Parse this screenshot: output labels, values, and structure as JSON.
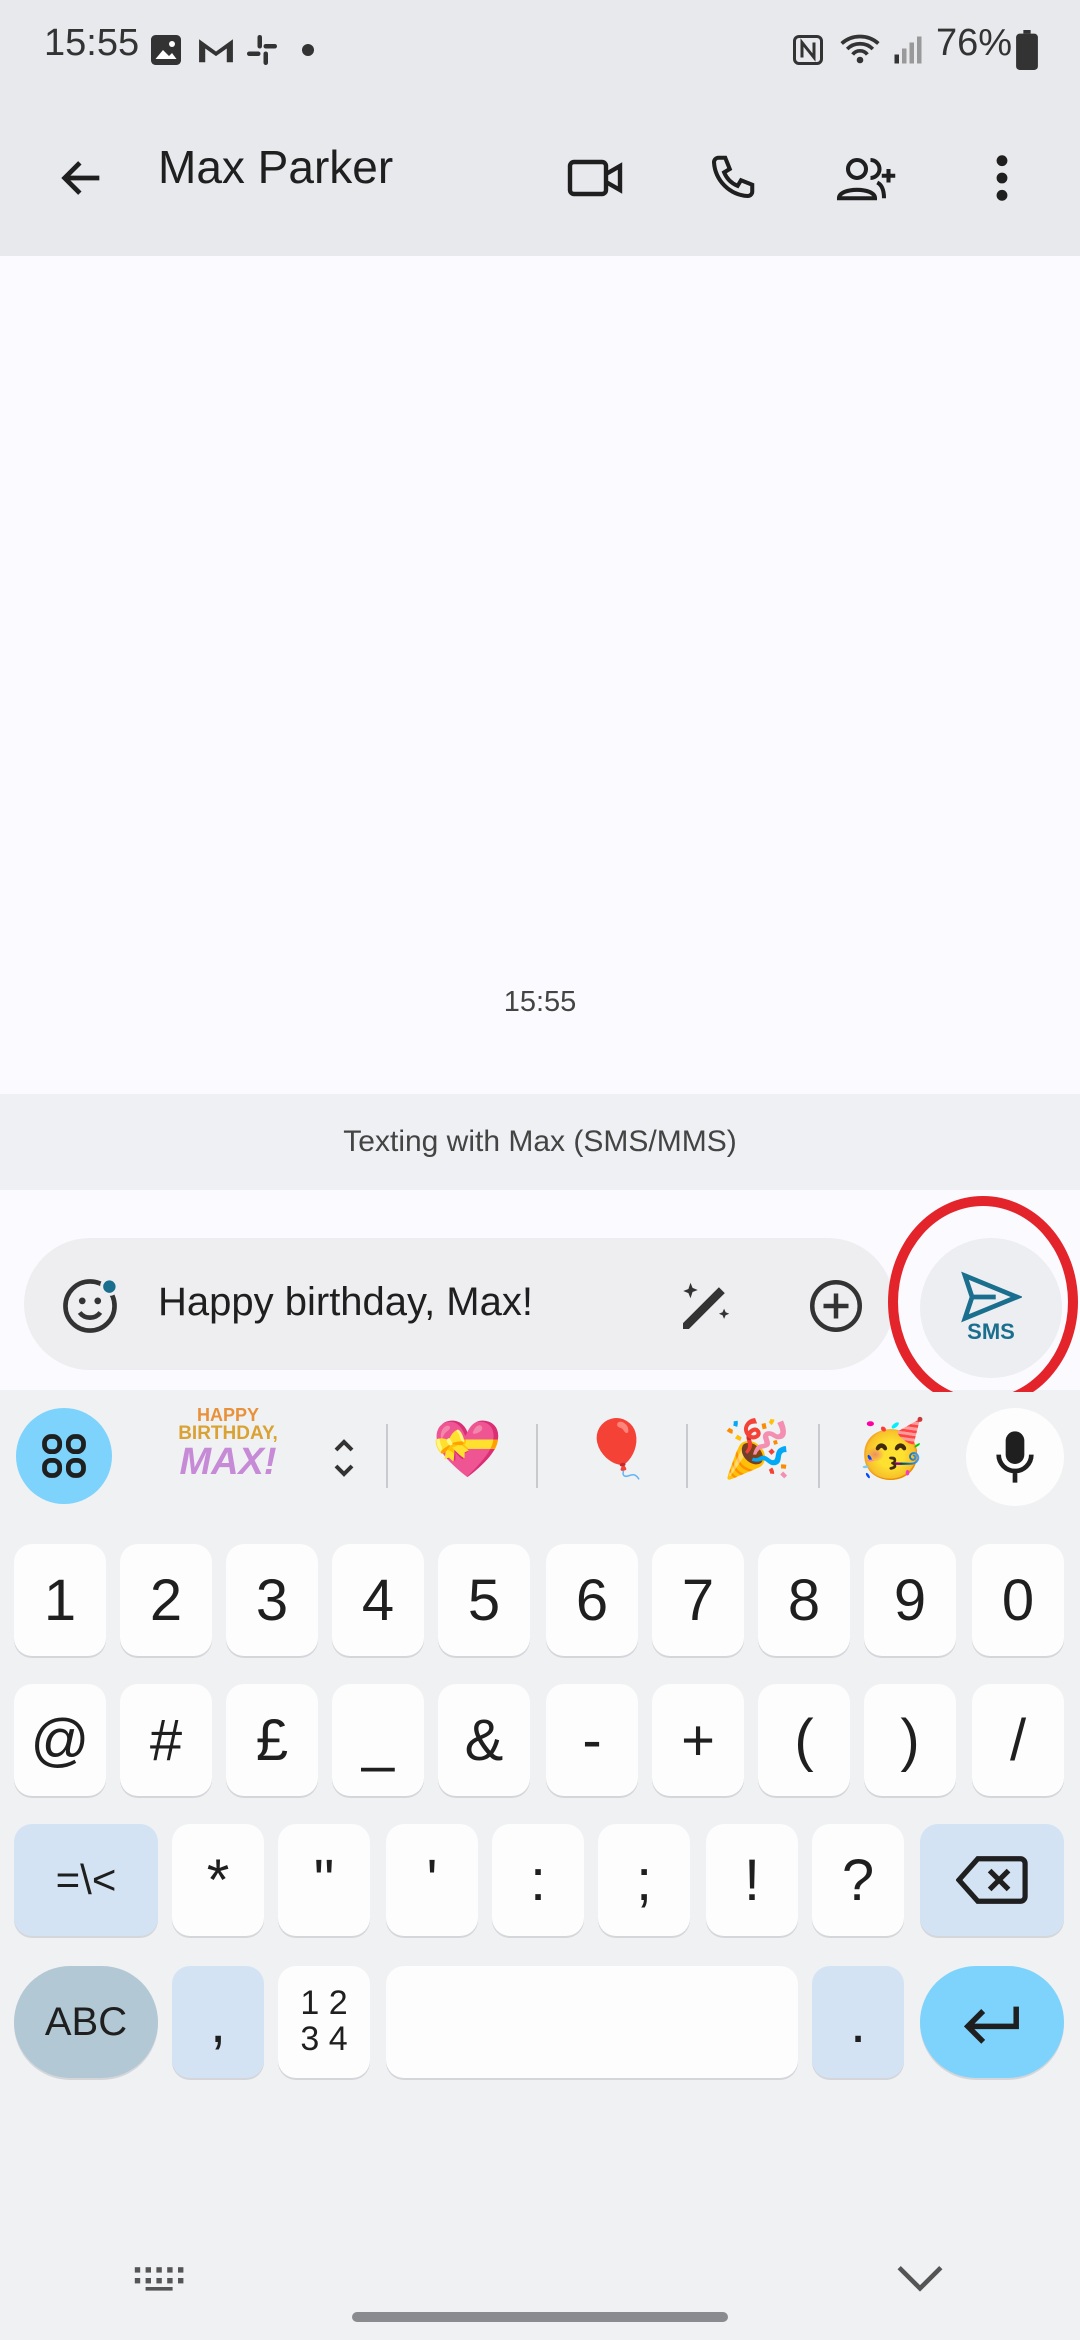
{
  "status_bar": {
    "time": "15:55",
    "battery": "76%",
    "notification_icons": [
      "gallery-icon",
      "gmail-icon",
      "slack-icon",
      "dot-icon"
    ],
    "system_icons": [
      "nfc-icon",
      "wifi-icon",
      "signal-icon",
      "battery-icon"
    ]
  },
  "app_bar": {
    "title": "Max Parker",
    "actions": [
      "video-call-icon",
      "phone-icon",
      "add-person-icon",
      "more-vert-icon"
    ]
  },
  "conversation": {
    "timestamp": "15:55",
    "notice": "Texting with Max (SMS/MMS)"
  },
  "composer": {
    "text": "Happy birthday, Max!",
    "send_label": "SMS"
  },
  "keyboard": {
    "sticker_text": [
      "HAPPY",
      "BIRTHDAY,",
      "MAX!"
    ],
    "suggestions": [
      "💝",
      "🎈",
      "🎉",
      "🥳"
    ],
    "row1": [
      "1",
      "2",
      "3",
      "4",
      "5",
      "6",
      "7",
      "8",
      "9",
      "0"
    ],
    "row2": [
      "@",
      "#",
      "£",
      "_",
      "&",
      "-",
      "+",
      "(",
      ")",
      "/"
    ],
    "row3": [
      "=\\<",
      "*",
      "\"",
      "'",
      ":",
      ";",
      "!",
      "?"
    ],
    "row4": {
      "abc": "ABC",
      "comma": ",",
      "numpad_top": "1 2",
      "numpad_bottom": "3 4",
      "period": "."
    }
  },
  "colors": {
    "accent": "#7dd3fb",
    "highlight": "#e3242b",
    "send_icon": "#1a6e8e"
  }
}
